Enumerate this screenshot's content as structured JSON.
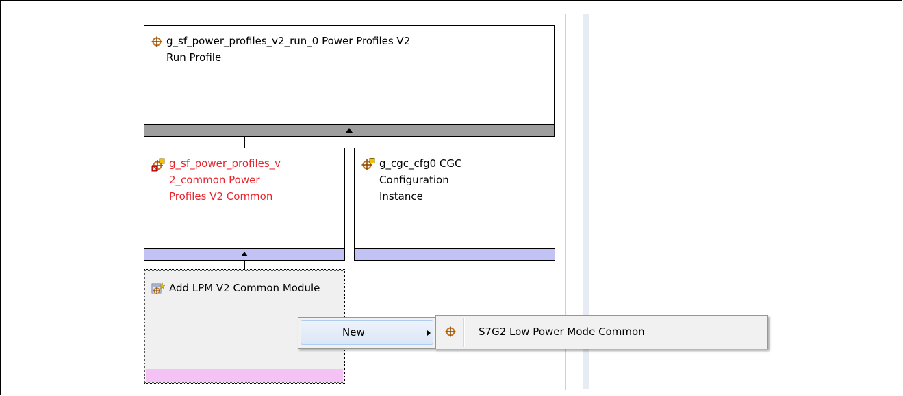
{
  "nodes": {
    "run_profile": {
      "title": "g_sf_power_profiles_v2_run_0 Power Profiles V2\nRun Profile"
    },
    "common": {
      "title": "g_sf_power_profiles_v\n2_common Power\nProfiles V2 Common",
      "color": "#e8242c"
    },
    "cgc": {
      "title": "g_cgc_cfg0 CGC\nConfiguration\nInstance"
    },
    "add_module": {
      "title": "Add LPM V2 Common\nModule"
    }
  },
  "context_menu": {
    "item_label": "New"
  },
  "submenu": {
    "item_label": "S7G2 Low Power Mode Common"
  },
  "icons": {
    "module": "crosshair-module-icon",
    "module_error": "module-error-icon",
    "add_module": "add-module-icon",
    "submenu_arrow": "chevron-right-icon",
    "expand": "triangle-up-icon"
  },
  "colors": {
    "footer_gray": "#9e9e9e",
    "footer_lavender": "#c2c2f5",
    "footer_pink": "#f5c2f5",
    "error_text": "#e8242c",
    "icon_orange": "#c8741a"
  }
}
